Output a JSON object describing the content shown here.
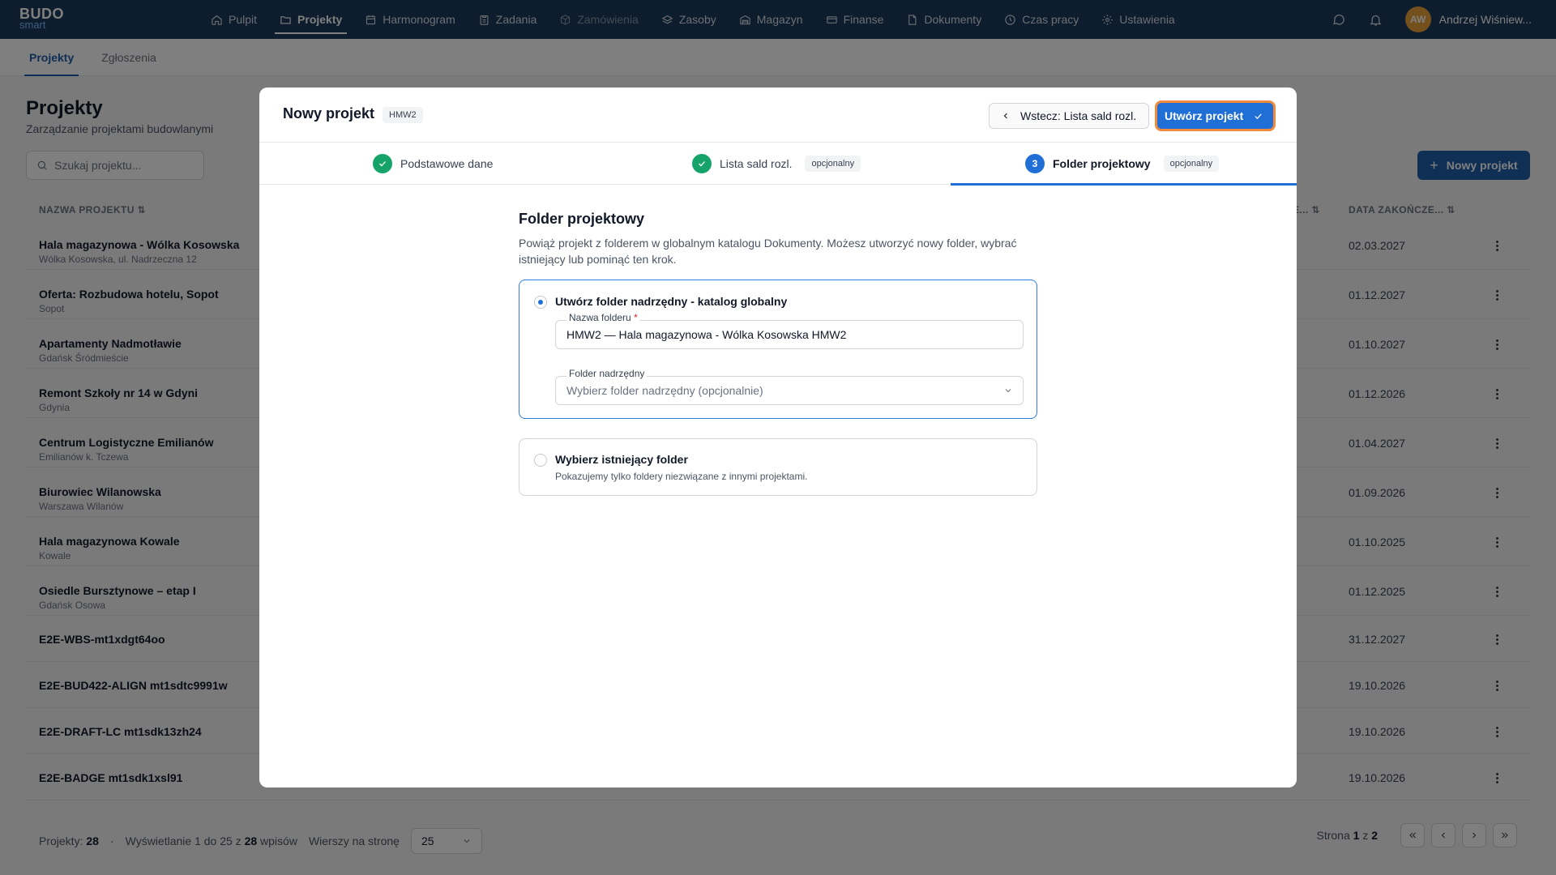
{
  "app": {
    "logo_top": "BUDO",
    "logo_bottom": "smart"
  },
  "nav": {
    "items": [
      {
        "label": "Pulpit",
        "icon": "home-icon"
      },
      {
        "label": "Projekty",
        "icon": "folder-icon"
      },
      {
        "label": "Harmonogram",
        "icon": "calendar-icon"
      },
      {
        "label": "Zadania",
        "icon": "clipboard-icon"
      },
      {
        "label": "Zamówienia",
        "icon": "box-icon"
      },
      {
        "label": "Zasoby",
        "icon": "layers-icon"
      },
      {
        "label": "Magazyn",
        "icon": "warehouse-icon"
      },
      {
        "label": "Finanse",
        "icon": "card-icon"
      },
      {
        "label": "Dokumenty",
        "icon": "document-icon"
      },
      {
        "label": "Czas pracy",
        "icon": "clock-icon"
      },
      {
        "label": "Ustawienia",
        "icon": "gear-icon"
      }
    ],
    "user_initials": "AW",
    "user_name": "Andrzej Wiśniew..."
  },
  "subtabs": [
    "Projekty",
    "Zgłoszenia"
  ],
  "page": {
    "title": "Projekty",
    "subtitle": "Zarządzanie projektami budowlanymi",
    "search_placeholder": "Szukaj projektu...",
    "new_button": "Nowy projekt",
    "col_name": "NAZWA PROJEKTU",
    "col_trunc": "E...",
    "col_end": "DATA ZAKOŃCZE..."
  },
  "rows": [
    {
      "name": "Hala magazynowa - Wólka Kosowska",
      "loc": "Wólka Kosowska, ul. Nadrzeczna 12",
      "date": "02.03.2027"
    },
    {
      "name": "Oferta: Rozbudowa hotelu, Sopot",
      "loc": "Sopot",
      "date": "01.12.2027"
    },
    {
      "name": "Apartamenty Nadmotławie",
      "loc": "Gdańsk Śródmieście",
      "date": "01.10.2027"
    },
    {
      "name": "Remont Szkoły nr 14 w Gdyni",
      "loc": "Gdynia",
      "date": "01.12.2026"
    },
    {
      "name": "Centrum Logistyczne Emilianów",
      "loc": "Emilianów k. Tczewa",
      "date": "01.04.2027"
    },
    {
      "name": "Biurowiec Wilanowska",
      "loc": "Warszawa Wilanów",
      "date": "01.09.2026"
    },
    {
      "name": "Hala magazynowa Kowale",
      "loc": "Kowale",
      "date": "01.10.2025"
    },
    {
      "name": "Osiedle Bursztynowe – etap I",
      "loc": "Gdańsk Osowa",
      "date": "01.12.2025"
    },
    {
      "name": "E2E-WBS-mt1xdgt64oo",
      "loc": "",
      "date": "31.12.2027"
    },
    {
      "name": "E2E-BUD422-ALIGN mt1sdtc9991w",
      "loc": "",
      "date": "19.10.2026"
    },
    {
      "name": "E2E-DRAFT-LC mt1sdk13zh24",
      "loc": "",
      "date": "19.10.2026"
    },
    {
      "name": "E2E-BADGE mt1sdk1xsl91",
      "loc": "",
      "date": "19.10.2026"
    }
  ],
  "footer": {
    "projects_label": "Projekty:",
    "projects_count": "28",
    "showing_prefix": "Wyświetlanie 1 do 25 z",
    "showing_total": "28",
    "showing_suffix": "wpisów",
    "rows_per_page_label": "Wierszy na stronę",
    "rows_per_page_value": "25",
    "page_prefix": "Strona",
    "page_current": "1",
    "page_of": "z",
    "page_total": "2"
  },
  "modal": {
    "title": "Nowy projekt",
    "code": "HMW2",
    "back_label": "Wstecz: Lista sald rozl.",
    "create_label": "Utwórz projekt",
    "steps": [
      {
        "label": "Podstawowe dane",
        "badge": "",
        "state": "done"
      },
      {
        "label": "Lista sald rozl.",
        "badge": "opcjonalny",
        "state": "done"
      },
      {
        "label": "Folder projektowy",
        "badge": "opcjonalny",
        "state": "current",
        "number": "3"
      }
    ],
    "section_title": "Folder projektowy",
    "section_desc": "Powiąż projekt z folderem w globalnym katalogu Dokumenty. Możesz utworzyć nowy folder, wybrać istniejący lub pominąć ten krok.",
    "option1_title": "Utwórz folder nadrzędny - katalog globalny",
    "folder_name_label": "Nazwa folderu",
    "folder_name_required": "*",
    "folder_name_value": "HMW2 — Hala magazynowa - Wólka Kosowska HMW2",
    "parent_label": "Folder nadrzędny",
    "parent_placeholder": "Wybierz folder nadrzędny (opcjonalnie)",
    "option2_title": "Wybierz istniejący folder",
    "option2_desc": "Pokazujemy tylko foldery niezwiązane z innymi projektami."
  },
  "colors": {
    "navbar": "#1b3a5c",
    "primary": "#1f6fd6",
    "success": "#16a36a",
    "focus_ring": "#f08a3c"
  }
}
